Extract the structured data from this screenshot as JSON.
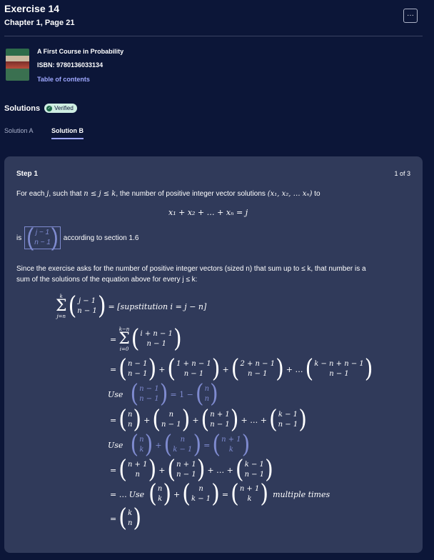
{
  "header": {
    "title": "Exercise 14",
    "subtitle": "Chapter 1, Page 21",
    "more_icon": "more-horizontal-icon",
    "more_label": "···"
  },
  "book": {
    "name": "A First Course in Probability",
    "isbn": "ISBN: 9780136033134",
    "toc_link": "Table of contents"
  },
  "solutions": {
    "heading": "Solutions",
    "badge": "Verified",
    "tabs": [
      "Solution A",
      "Solution B"
    ],
    "active_tab": "Solution B"
  },
  "step": {
    "title": "Step 1",
    "counter": "1 of 3",
    "line1_a": "For each ",
    "line1_j": "j",
    "line1_b": ", such that ",
    "line1_cond": "n ≤ j ≤ k",
    "line1_c": ", the number of positive integer vector solutions ",
    "line1_vec": "(x₁, x₂, … xₙ)",
    "line1_d": " to",
    "equation": "x₁ + x₂ + … + xₙ = j",
    "line3_is": "is",
    "binom_top": "j − 1",
    "binom_bottom": "n − 1",
    "line3_after": "according to section 1.6",
    "line4": "Since the exercise asks for the number of positive integer vectors (sized n) that sum up to ≤ k, that number is a",
    "line5": "sum of the solutions of the equation above for every j ≤ k:",
    "subst": "= [supstitution   i = j − n]",
    "use": "Use",
    "multiple": "multiple times",
    "final_top": "k",
    "final_bottom": "n"
  }
}
